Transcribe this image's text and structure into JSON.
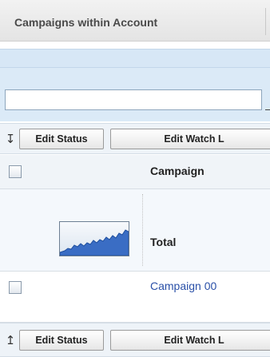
{
  "header": {
    "tab_label": "Campaigns within Account"
  },
  "filter": {
    "value": "",
    "placeholder": ""
  },
  "actions_top": {
    "arrow_icon": "arrow-down-icon",
    "edit_status_label": "Edit Status",
    "edit_watch_label": "Edit Watch L"
  },
  "table": {
    "column_header": "Campaign",
    "total_label": "Total",
    "rows": [
      {
        "name": "Campaign 00"
      }
    ]
  },
  "actions_bottom": {
    "arrow_icon": "arrow-up-icon",
    "edit_status_label": "Edit Status",
    "edit_watch_label": "Edit Watch L"
  },
  "colors": {
    "link": "#2a50a8",
    "panel_blue": "#dbeaf7",
    "sparkline_fill": "#3a6dc4"
  }
}
